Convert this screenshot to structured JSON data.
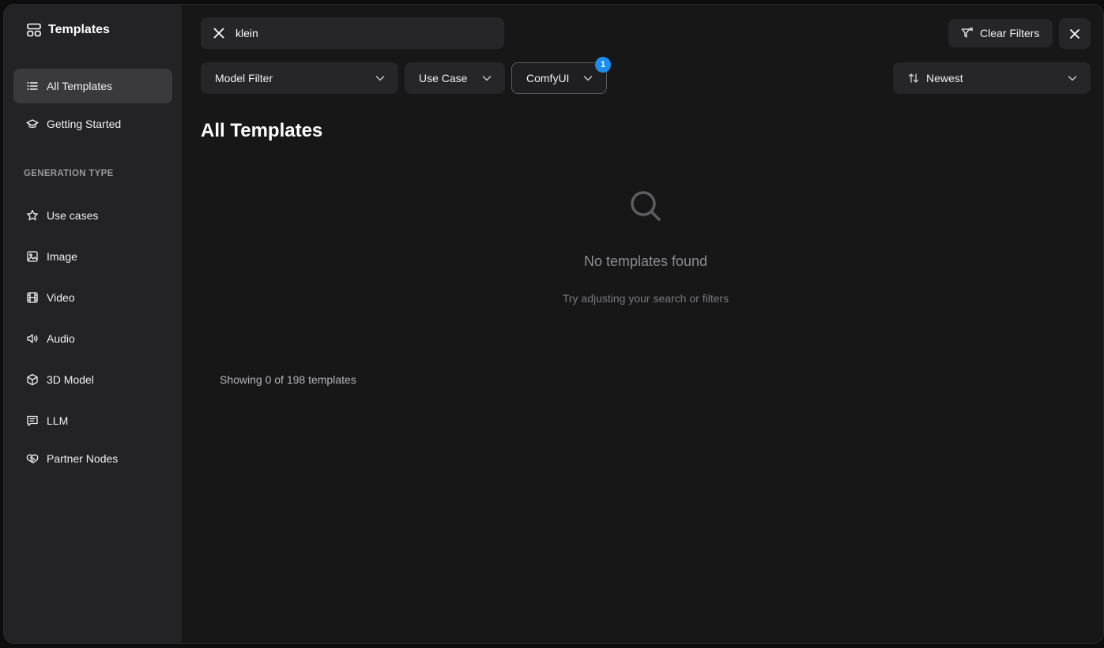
{
  "sidebar": {
    "title": "Templates",
    "items_top": [
      {
        "label": "All Templates",
        "icon": "list-icon",
        "active": true
      },
      {
        "label": "Getting Started",
        "icon": "graduation-cap-icon",
        "active": false
      }
    ],
    "section_label": "GENERATION TYPE",
    "items_generation": [
      {
        "label": "Use cases",
        "icon": "star-icon"
      },
      {
        "label": "Image",
        "icon": "image-icon"
      },
      {
        "label": "Video",
        "icon": "film-icon"
      },
      {
        "label": "Audio",
        "icon": "speaker-icon"
      },
      {
        "label": "3D Model",
        "icon": "cube-icon"
      },
      {
        "label": "LLM",
        "icon": "chat-icon"
      },
      {
        "label": "Partner Nodes",
        "icon": "handshake-icon"
      }
    ]
  },
  "search": {
    "value": "klein"
  },
  "toolbar": {
    "clear_filters_label": "Clear Filters",
    "filters": {
      "model": "Model Filter",
      "use_case": "Use Case",
      "comfy": "ComfyUI",
      "comfy_badge": "1"
    },
    "sort_label": "Newest"
  },
  "main": {
    "title": "All Templates",
    "empty_title": "No templates found",
    "empty_subtitle": "Try adjusting your search or filters",
    "showing_text": "Showing 0 of 198 templates"
  },
  "colors": {
    "accent_badge": "#1c8ef0",
    "background": "#171718",
    "sidebar": "#232325"
  }
}
